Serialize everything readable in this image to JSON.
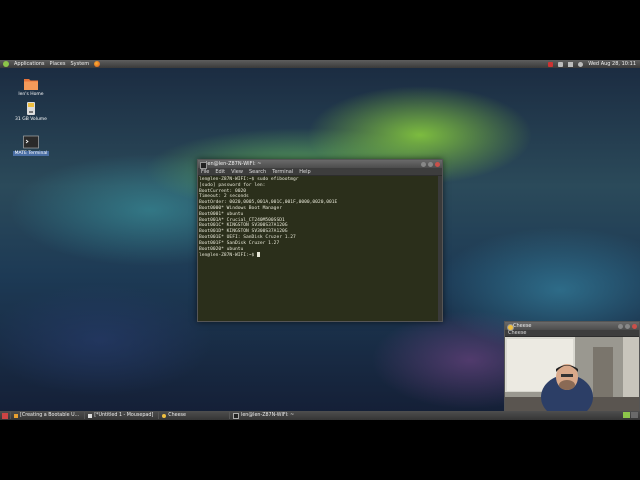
{
  "panel": {
    "menus": [
      "Applications",
      "Places",
      "System"
    ],
    "clock": "Wed Aug 28, 10:11"
  },
  "desktop_icons": [
    {
      "label": "len's Home",
      "icon": "home-folder-icon"
    },
    {
      "label": "31 GB Volume",
      "icon": "drive-icon"
    },
    {
      "label": "MATE Terminal",
      "icon": "terminal-icon"
    }
  ],
  "terminal": {
    "title": "len@len-Z87N-WIFI: ~",
    "menu": [
      "File",
      "Edit",
      "View",
      "Search",
      "Terminal",
      "Help"
    ],
    "lines": [
      "len@len-Z87N-WIFI:~$ sudo efibootmgr",
      "[sudo] password for len:",
      "BootCurrent: 0020",
      "Timeout: 2 seconds",
      "BootOrder: 0020,0005,001A,001C,001F,0000,0020,001E",
      "Boot0000* Windows Boot Manager",
      "Boot0001* ubuntu",
      "Boot001A* Crucial_CT240M500SSD1",
      "Boot001C* KINGSTON SV300S37A120G",
      "Boot001D* KINGSTON SV300S37A120G",
      "Boot001E* UEFI: SanDisk Cruzer 1.27",
      "Boot001F* SanDisk Cruzer 1.27",
      "Boot0020* ubuntu"
    ],
    "prompt": "len@len-Z87N-WIFI:~$ "
  },
  "cheese": {
    "title": "Cheese",
    "menu": "Cheese"
  },
  "taskbar": {
    "tasks": [
      {
        "label": "[Creating a Bootable U...",
        "icon": "browser-icon"
      },
      {
        "label": "[*Untitled 1 - Mousepad]",
        "icon": "editor-icon"
      },
      {
        "label": "Cheese",
        "icon": "cheese-icon"
      },
      {
        "label": "len@len-Z87N-WIFI: ~",
        "icon": "terminal-icon"
      }
    ]
  },
  "colors": {
    "terminal_bg": "#2b2f1b",
    "terminal_fg": "#e8e8d8",
    "accent": "#8cc54a"
  }
}
